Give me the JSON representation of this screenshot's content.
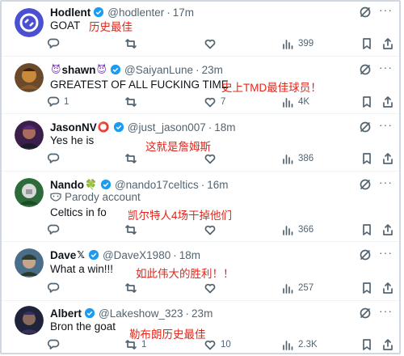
{
  "replies": [
    {
      "name": "Hodlent",
      "emoji": "",
      "handle": "@hodlenter",
      "time": "17m",
      "text": "GOAT",
      "annotation": "历史最佳",
      "parody": "",
      "stats": {
        "replies": "",
        "reposts": "",
        "likes": "",
        "views": "399"
      }
    },
    {
      "name": "shawn",
      "emoji": "😈",
      "handle": "@SaiyanLune",
      "time": "23m",
      "text": "GREATEST OF ALL FUCKING TIME",
      "annotation": "史上TMD最佳球员！",
      "parody": "",
      "stats": {
        "replies": "1",
        "reposts": "",
        "likes": "7",
        "views": "4K"
      }
    },
    {
      "name": "JasonNV",
      "emoji": "⭕",
      "handle": "@just_jason007",
      "time": "18m",
      "text": "Yes he is",
      "annotation": "这就是詹姆斯",
      "parody": "",
      "stats": {
        "replies": "",
        "reposts": "",
        "likes": "",
        "views": "386"
      }
    },
    {
      "name": "Nando",
      "emoji": "🍀",
      "handle": "@nando17celtics",
      "time": "16m",
      "text": "Celtics in fo",
      "annotation": "凯尔特人4场干掉他们",
      "parody": "Parody account",
      "stats": {
        "replies": "",
        "reposts": "",
        "likes": "",
        "views": "366"
      }
    },
    {
      "name": "Dave",
      "emoji": "𝕏",
      "handle": "@DaveX1980",
      "time": "18m",
      "text": "What a win!!!",
      "annotation": "如此伟大的胜利！！",
      "parody": "",
      "stats": {
        "replies": "",
        "reposts": "",
        "likes": "",
        "views": "257"
      }
    },
    {
      "name": "Albert",
      "emoji": "",
      "handle": "@Lakeshow_323",
      "time": "23m",
      "text": "Bron the goat",
      "annotation": "勒布朗历史最佳",
      "parody": "",
      "stats": {
        "replies": "",
        "reposts": "1",
        "likes": "10",
        "views": "2.3K"
      }
    }
  ],
  "separator": "·",
  "more_glyph": "···",
  "icons": [
    "reply-icon",
    "repost-icon",
    "like-icon",
    "views-icon",
    "bookmark-icon",
    "share-icon",
    "grok-icon",
    "verified-badge-icon",
    "more-icon",
    "parody-mask-icon"
  ],
  "colors": {
    "verified": "#1d9bf0",
    "annotation": "#e0261b",
    "muted": "#536471",
    "text": "#0f1419"
  }
}
